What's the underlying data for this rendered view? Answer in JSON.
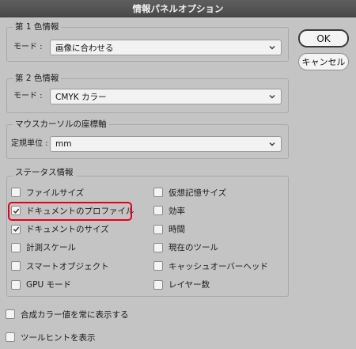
{
  "window": {
    "title": "情報パネルオプション"
  },
  "first_color": {
    "legend": "第 1 色情報",
    "mode_label": "モード :",
    "mode_value": "画像に合わせる"
  },
  "second_color": {
    "legend": "第 2 色情報",
    "mode_label": "モード :",
    "mode_value": "CMYK カラー"
  },
  "mouse_coords": {
    "legend": "マウスカーソルの座標軸",
    "unit_label": "定規単位 :",
    "unit_value": "mm"
  },
  "status": {
    "legend": "ステータス情報",
    "left": [
      {
        "label": "ファイルサイズ",
        "checked": false
      },
      {
        "label": "ドキュメントのプロファイル",
        "checked": true
      },
      {
        "label": "ドキュメントのサイズ",
        "checked": true
      },
      {
        "label": "計測スケール",
        "checked": false
      },
      {
        "label": "スマートオブジェクト",
        "checked": false
      },
      {
        "label": "GPU モード",
        "checked": false
      }
    ],
    "right": [
      {
        "label": "仮想記憶サイズ",
        "checked": false
      },
      {
        "label": "効率",
        "checked": false
      },
      {
        "label": "時間",
        "checked": false
      },
      {
        "label": "現在のツール",
        "checked": false
      },
      {
        "label": "キャッシュオーバーヘッド",
        "checked": false
      },
      {
        "label": "レイヤー数",
        "checked": false
      }
    ]
  },
  "options": [
    {
      "label": "合成カラー値を常に表示する",
      "checked": false
    },
    {
      "label": "ツールヒントを表示",
      "checked": false
    }
  ],
  "buttons": {
    "ok": "OK",
    "cancel": "キャンセル"
  },
  "colors": {
    "highlight": "#e3001b",
    "background": "#c4c4c4"
  }
}
